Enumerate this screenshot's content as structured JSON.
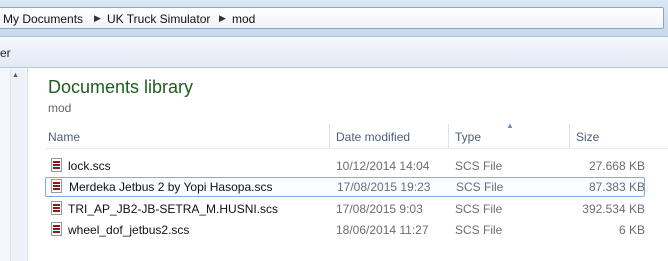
{
  "breadcrumb": {
    "items": [
      "My Documents",
      "UK Truck Simulator",
      "mod"
    ]
  },
  "toolbar": {
    "organize_label": "er"
  },
  "library": {
    "title": "Documents library",
    "subtitle": "mod"
  },
  "columns": {
    "name": "Name",
    "date_modified": "Date modified",
    "type": "Type",
    "size": "Size"
  },
  "files": [
    {
      "name": "lock.scs",
      "date": "10/12/2014 14:04",
      "type": "SCS File",
      "size": "27.668 KB",
      "icon": "scs-file-icon"
    },
    {
      "name": "Merdeka Jetbus 2 by Yopi Hasopa.scs",
      "date": "17/08/2015 19:23",
      "type": "SCS File",
      "size": "87.383 KB",
      "icon": "scs-file-icon",
      "selected": true
    },
    {
      "name": "TRI_AP_JB2-JB-SETRA_M.HUSNI.scs",
      "date": "17/08/2015 9:03",
      "type": "SCS File",
      "size": "392.534 KB",
      "icon": "scs-file-icon"
    },
    {
      "name": "wheel_dof_jetbus2.scs",
      "date": "18/06/2014 11:27",
      "type": "SCS File",
      "size": "6 KB",
      "icon": "scs-file-icon"
    }
  ],
  "colors": {
    "library_title": "#1e5d1e",
    "selection_border": "#84acdd",
    "header_text": "#4c607a"
  }
}
